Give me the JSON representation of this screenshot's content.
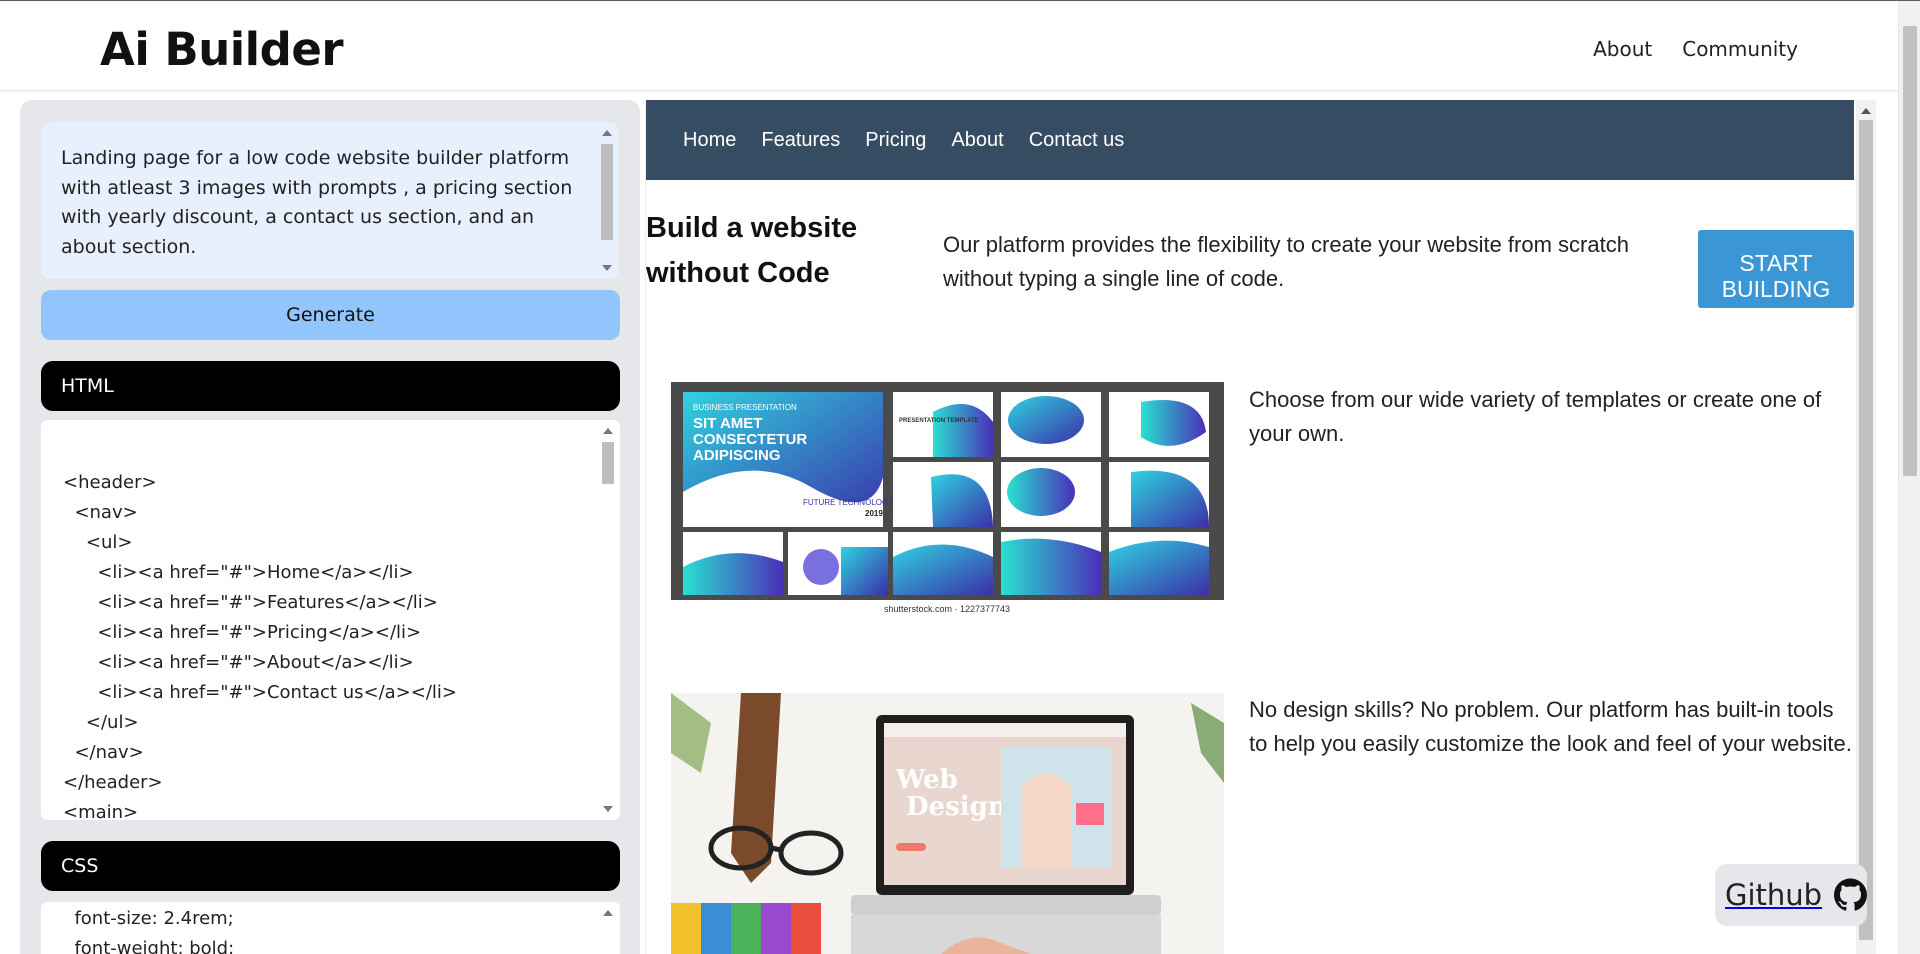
{
  "app": {
    "brand": "Ai Builder",
    "nav": [
      "About",
      "Community"
    ]
  },
  "prompt": {
    "text": "Landing page for a low code website builder platform with atleast 3 images with prompts , a pricing section with yearly discount, a contact us section, and an about section."
  },
  "generate_label": "Generate",
  "html_panel": {
    "title": "HTML",
    "lines": [
      "",
      "<header>",
      "  <nav>",
      "    <ul>",
      "      <li><a href=\"#\">Home</a></li>",
      "      <li><a href=\"#\">Features</a></li>",
      "      <li><a href=\"#\">Pricing</a></li>",
      "      <li><a href=\"#\">About</a></li>",
      "      <li><a href=\"#\">Contact us</a></li>",
      "    </ul>",
      "  </nav>",
      "</header>",
      "<main>"
    ]
  },
  "css_panel": {
    "title": "CSS",
    "lines": [
      "  font-size: 2.4rem;",
      "  font-weight: bold;"
    ]
  },
  "preview": {
    "nav": [
      "Home",
      "Features",
      "Pricing",
      "About",
      "Contact us"
    ],
    "hero_title": "Build a website without Code",
    "hero_text": "Our platform provides the flexibility to create your website from scratch without typing a single line of code.",
    "cta": "START BUILDING",
    "feature1": {
      "text": "Choose from our wide variety of templates or create one of your own.",
      "img_headline": "SIT AMET CONSECTETUR ADIPISCING",
      "img_kicker": "BUSINESS PRESENTATION",
      "img_sub": "FUTURE TECHNOLOGY",
      "img_year": "2019",
      "img_tile_label": "PRESENTATION TEMPLATE",
      "img_caption": "shutterstock.com · 1227377743"
    },
    "feature2": {
      "text": "No design skills? No problem. Our platform has built-in tools to help you easily customize the look and feel of your website.",
      "screen_title": "Web Design"
    }
  },
  "github_label": "Github",
  "colors": {
    "preview_nav": "#354c62",
    "cta": "#3b96d6",
    "generate": "#93c5fd",
    "prompt_bg": "#e8f0fe"
  }
}
